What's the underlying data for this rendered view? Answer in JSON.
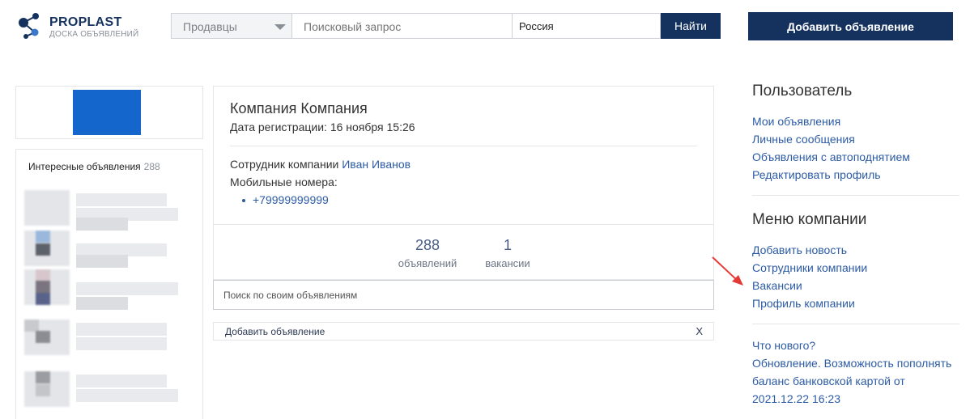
{
  "header": {
    "logo_title": "PROPLAST",
    "logo_subtitle": "ДОСКА ОБЪЯВЛЕНИЙ",
    "sellers_label": "Продавцы",
    "search_placeholder": "Поисковый запрос",
    "region_value": "Россия",
    "find_button": "Найти",
    "add_ad_button": "Добавить объявление"
  },
  "left": {
    "interesting_label": "Интересные объявления",
    "interesting_count": "288"
  },
  "company": {
    "name": "Компания Компания",
    "reg_date": "Дата регистрации: 16 ноября 15:26",
    "employee_label": "Сотрудник компании",
    "employee_name": "Иван Иванов",
    "mobile_label": "Мобильные номера:",
    "phone": "+79999999999",
    "stats": [
      {
        "num": "288",
        "label": "объявлений"
      },
      {
        "num": "1",
        "label": "вакансии"
      }
    ]
  },
  "own_search": {
    "placeholder": "Поиск по своим объявлениям"
  },
  "add_row": {
    "label": "Добавить объявление",
    "close": "X"
  },
  "sidebar": {
    "user_title": "Пользователь",
    "user_links": [
      "Мои объявления",
      "Личные сообщения",
      "Объявления с автоподнятием",
      "Редактировать профиль"
    ],
    "company_title": "Меню компании",
    "company_links": [
      "Добавить новость",
      "Сотрудники компании",
      "Вакансии",
      "Профиль компании"
    ],
    "news_title": "Что нового?",
    "news_text": "Обновление. Возможность пополнять баланс банковской картой от 2021.12.22 16:23"
  },
  "colors": {
    "brand": "#15325f",
    "link": "#2c5ba5",
    "company_logo": "#1466cc",
    "annotation_arrow": "#e53935"
  },
  "icons": {
    "logo": "molecule-icon",
    "dropdown": "chevron-down-icon",
    "annotation": "red-arrow-icon"
  }
}
